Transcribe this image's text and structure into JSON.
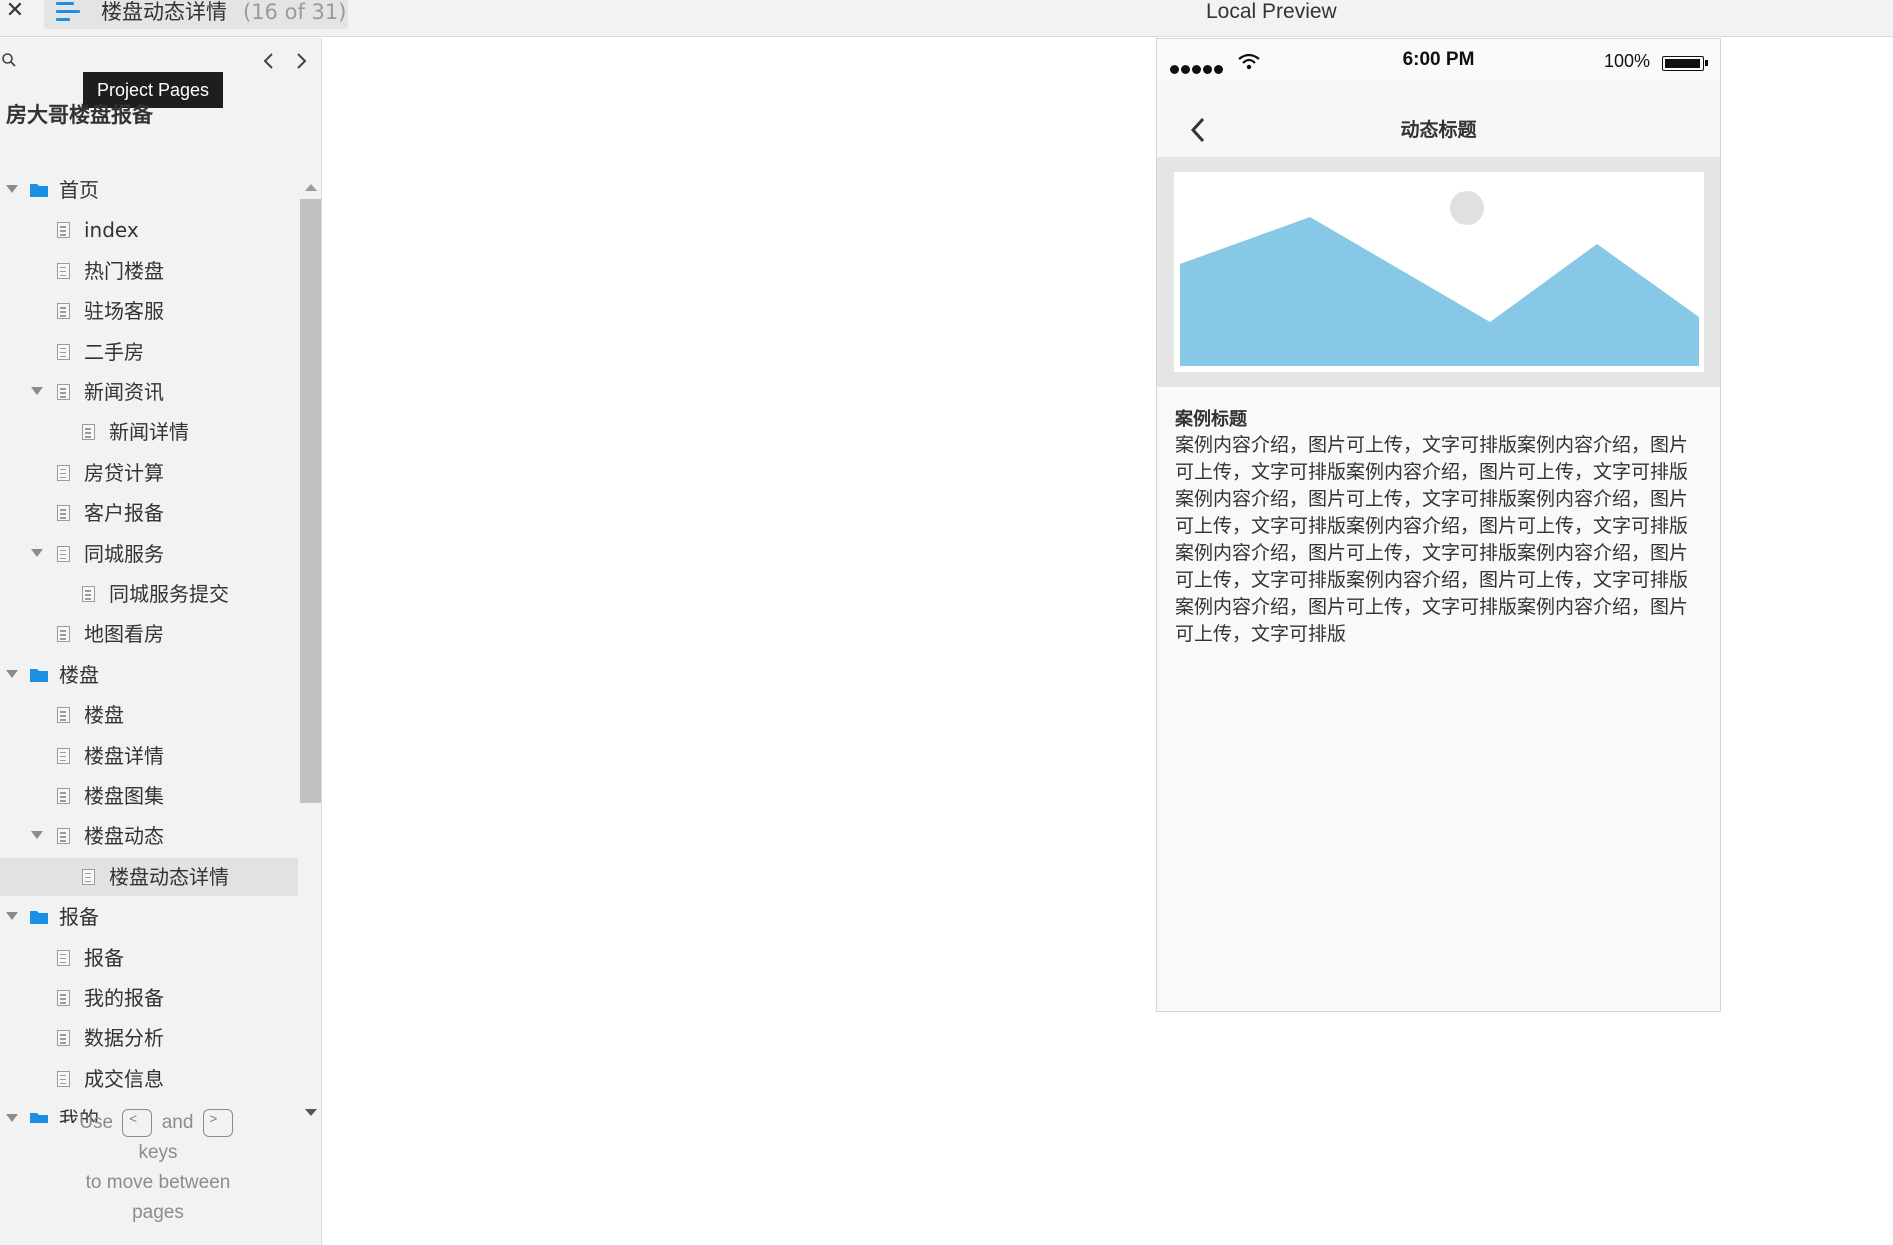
{
  "topbar": {
    "page_name": "楼盘动态详情",
    "page_count": "(16 of 31)",
    "preview_title": "Local Preview"
  },
  "sidebar": {
    "tooltip": "Project Pages",
    "project_name": "房大哥楼盘报备",
    "tree": [
      {
        "label": "首页",
        "type": "folder"
      },
      {
        "label": "index",
        "type": "page"
      },
      {
        "label": "热门楼盘",
        "type": "page"
      },
      {
        "label": "驻场客服",
        "type": "page"
      },
      {
        "label": "二手房",
        "type": "page"
      },
      {
        "label": "新闻资讯",
        "type": "page"
      },
      {
        "label": "新闻详情",
        "type": "page"
      },
      {
        "label": "房贷计算",
        "type": "page"
      },
      {
        "label": "客户报备",
        "type": "page"
      },
      {
        "label": "同城服务",
        "type": "page"
      },
      {
        "label": "同城服务提交",
        "type": "page"
      },
      {
        "label": "地图看房",
        "type": "page"
      },
      {
        "label": "楼盘",
        "type": "folder"
      },
      {
        "label": "楼盘",
        "type": "page"
      },
      {
        "label": "楼盘详情",
        "type": "page"
      },
      {
        "label": "楼盘图集",
        "type": "page"
      },
      {
        "label": "楼盘动态",
        "type": "page"
      },
      {
        "label": "楼盘动态详情",
        "type": "page",
        "selected": true
      },
      {
        "label": "报备",
        "type": "folder"
      },
      {
        "label": "报备",
        "type": "page"
      },
      {
        "label": "我的报备",
        "type": "page"
      },
      {
        "label": "数据分析",
        "type": "page"
      },
      {
        "label": "成交信息",
        "type": "page"
      },
      {
        "label": "我的",
        "type": "folder"
      }
    ],
    "help": {
      "use": "Use",
      "prev_key": "<",
      "and": "and",
      "next_key": ">",
      "line2": "keys",
      "line3": "to move between",
      "line4": "pages"
    }
  },
  "phone": {
    "time": "6:00 PM",
    "battery": "100%",
    "nav_title": "动态标题",
    "case_title": "案例标题",
    "case_body": "案例内容介绍，图片可上传，文字可排版案例内容介绍，图片可上传，文字可排版案例内容介绍，图片可上传，文字可排版案例内容介绍，图片可上传，文字可排版案例内容介绍，图片可上传，文字可排版案例内容介绍，图片可上传，文字可排版案例内容介绍，图片可上传，文字可排版案例内容介绍，图片可上传，文字可排版案例内容介绍，图片可上传，文字可排版案例内容介绍，图片可上传，文字可排版案例内容介绍，图片可上传，文字可排版"
  },
  "colors": {
    "accent": "#1a8fe3",
    "image_placeholder": "#87c8e6",
    "selected_row": "#e2e2e2"
  }
}
